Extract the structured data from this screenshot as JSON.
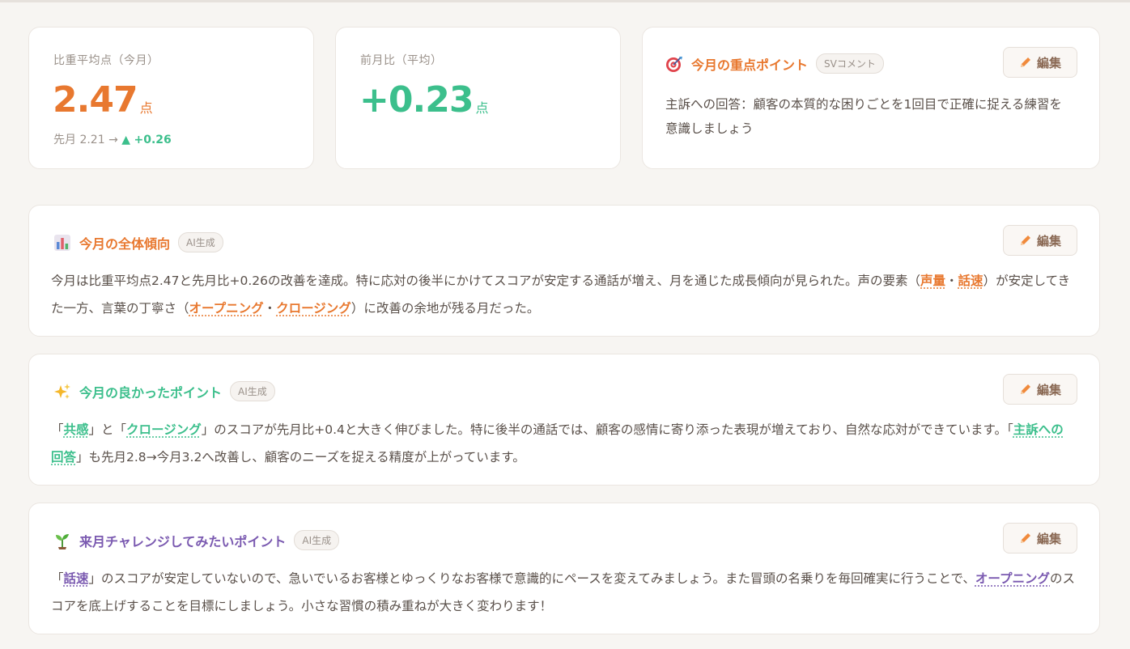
{
  "stats": {
    "avg": {
      "label": "比重平均点（今月）",
      "value": "2.47",
      "unit": "点",
      "prev_text": "先月 2.21 →",
      "delta_arrow": "▲",
      "delta": "+0.26"
    },
    "mom": {
      "label": "前月比（平均）",
      "value": "+0.23",
      "unit": "点"
    }
  },
  "focus": {
    "title": "今月の重点ポイント",
    "tag": "SVコメント",
    "edit_label": "編集",
    "text": "主訴への回答：顧客の本質的な困りごとを1回目で正確に捉える練習を意識しましょう"
  },
  "trend": {
    "title": "今月の全体傾向",
    "tag": "AI生成",
    "edit_label": "編集",
    "t1": "今月は比重平均点2.47と先月比+0.26の改善を達成。特に応対の後半にかけてスコアが安定する通話が増え、月を通じた成長傾向が見られた。声の要素（",
    "k1": "声量",
    "t2": "・",
    "k2": "話速",
    "t3": "）が安定してきた一方、言葉の丁寧さ（",
    "k3": "オープニング",
    "t4": "・",
    "k4": "クロージング",
    "t5": "）に改善の余地が残る月だった。"
  },
  "good": {
    "title": "今月の良かったポイント",
    "tag": "AI生成",
    "edit_label": "編集",
    "t1": "「",
    "k1": "共感",
    "t2": "」と「",
    "k2": "クロージング",
    "t3": "」のスコアが先月比+0.4と大きく伸びました。特に後半の通話では、顧客の感情に寄り添った表現が増えており、自然な応対ができています。「",
    "k3": "主訴への回答",
    "t4": "」も先月2.8→今月3.2へ改善し、顧客のニーズを捉える精度が上がっています。"
  },
  "challenge": {
    "title": "来月チャレンジしてみたいポイント",
    "tag": "AI生成",
    "edit_label": "編集",
    "t1": "「",
    "k1": "話速",
    "t2": "」のスコアが安定していないので、急いでいるお客様とゆっくりなお客様で意識的にペースを変えてみましょう。また冒頭の名乗りを毎回確実に行うことで、",
    "k2": "オープニング",
    "t3": "のスコアを底上げすることを目標にしましょう。小さな習慣の積み重ねが大きく変わります！"
  },
  "icons": {
    "focus": "target-icon",
    "trend": "bar-chart-icon",
    "good": "sparkles-icon",
    "challenge": "seedling-icon",
    "edit": "pencil-icon"
  },
  "colors": {
    "orange": "#e8782f",
    "green": "#3cbf8c",
    "purple": "#7a59b0",
    "background": "#f7f5f2"
  }
}
